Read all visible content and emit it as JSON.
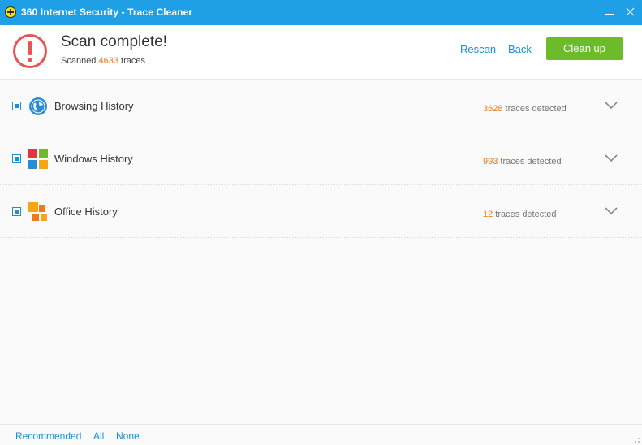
{
  "window": {
    "title": "360 Internet Security - Trace Cleaner"
  },
  "header": {
    "title": "Scan complete!",
    "scanned_prefix": "Scanned ",
    "scanned_count": "4633",
    "scanned_suffix": " traces",
    "rescan_label": "Rescan",
    "back_label": "Back",
    "cleanup_label": "Clean up"
  },
  "categories": [
    {
      "label": "Browsing History",
      "count": "3628",
      "count_suffix": " traces detected",
      "icon": "globe-icon",
      "checked": true
    },
    {
      "label": "Windows History",
      "count": "993",
      "count_suffix": " traces detected",
      "icon": "windows-icon",
      "checked": true
    },
    {
      "label": "Office History",
      "count": "12",
      "count_suffix": " traces detected",
      "icon": "office-icon",
      "checked": true
    }
  ],
  "footer": {
    "recommended_label": "Recommended",
    "all_label": "All",
    "none_label": "None"
  },
  "colors": {
    "titlebar": "#1f9fe6",
    "accent_link": "#1a8fd8",
    "cleanup_button": "#6cbb2a",
    "count_highlight": "#f07a1a",
    "warning": "#e85454"
  }
}
